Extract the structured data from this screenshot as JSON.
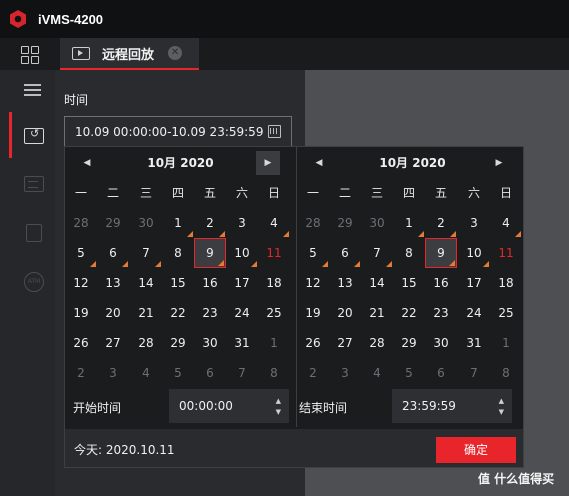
{
  "app": {
    "title": "iVMS-4200"
  },
  "tab": {
    "label": "远程回放",
    "close": "✕"
  },
  "panel": {
    "time_label": "时间",
    "time_value": "10.09 00:00:00-10.09 23:59:59"
  },
  "calendar_left": {
    "title": "10月  2020",
    "prev": "◀",
    "next": "▶",
    "weekdays": [
      "一",
      "二",
      "三",
      "四",
      "五",
      "六",
      "日"
    ],
    "weeks": [
      [
        "28",
        "29",
        "30",
        "1",
        "2",
        "3",
        "4"
      ],
      [
        "5",
        "6",
        "7",
        "8",
        "9",
        "10",
        "11"
      ],
      [
        "12",
        "13",
        "14",
        "15",
        "16",
        "17",
        "18"
      ],
      [
        "19",
        "20",
        "21",
        "22",
        "23",
        "24",
        "25"
      ],
      [
        "26",
        "27",
        "28",
        "29",
        "30",
        "31",
        "1"
      ],
      [
        "2",
        "3",
        "4",
        "5",
        "6",
        "7",
        "8"
      ]
    ]
  },
  "calendar_right": {
    "title": "10月  2020",
    "prev": "◀",
    "next": "▶",
    "weekdays": [
      "一",
      "二",
      "三",
      "四",
      "五",
      "六",
      "日"
    ],
    "weeks": [
      [
        "28",
        "29",
        "30",
        "1",
        "2",
        "3",
        "4"
      ],
      [
        "5",
        "6",
        "7",
        "8",
        "9",
        "10",
        "11"
      ],
      [
        "12",
        "13",
        "14",
        "15",
        "16",
        "17",
        "18"
      ],
      [
        "19",
        "20",
        "21",
        "22",
        "23",
        "24",
        "25"
      ],
      [
        "26",
        "27",
        "28",
        "29",
        "30",
        "31",
        "1"
      ],
      [
        "2",
        "3",
        "4",
        "5",
        "6",
        "7",
        "8"
      ]
    ]
  },
  "start_time": {
    "label": "开始时间",
    "value": "00:00:00",
    "up": "▲",
    "down": "▼"
  },
  "end_time": {
    "label": "结束时间",
    "value": "23:59:59",
    "up": "▲",
    "down": "▼"
  },
  "footer": {
    "today": "今天: 2020.10.11",
    "ok": "确定"
  },
  "watermark": "值 什么值得买",
  "colors": {
    "accent": "#e8252b",
    "record_marker": "#e57a35",
    "popup_bg": "#1b1c1e"
  },
  "icons": [
    "logo-icon",
    "grid-icon",
    "playback-tab-icon",
    "close-icon",
    "menu-icon",
    "remote-playback-icon",
    "event-list-icon",
    "device-icon",
    "atm-icon",
    "calendar-icon"
  ]
}
